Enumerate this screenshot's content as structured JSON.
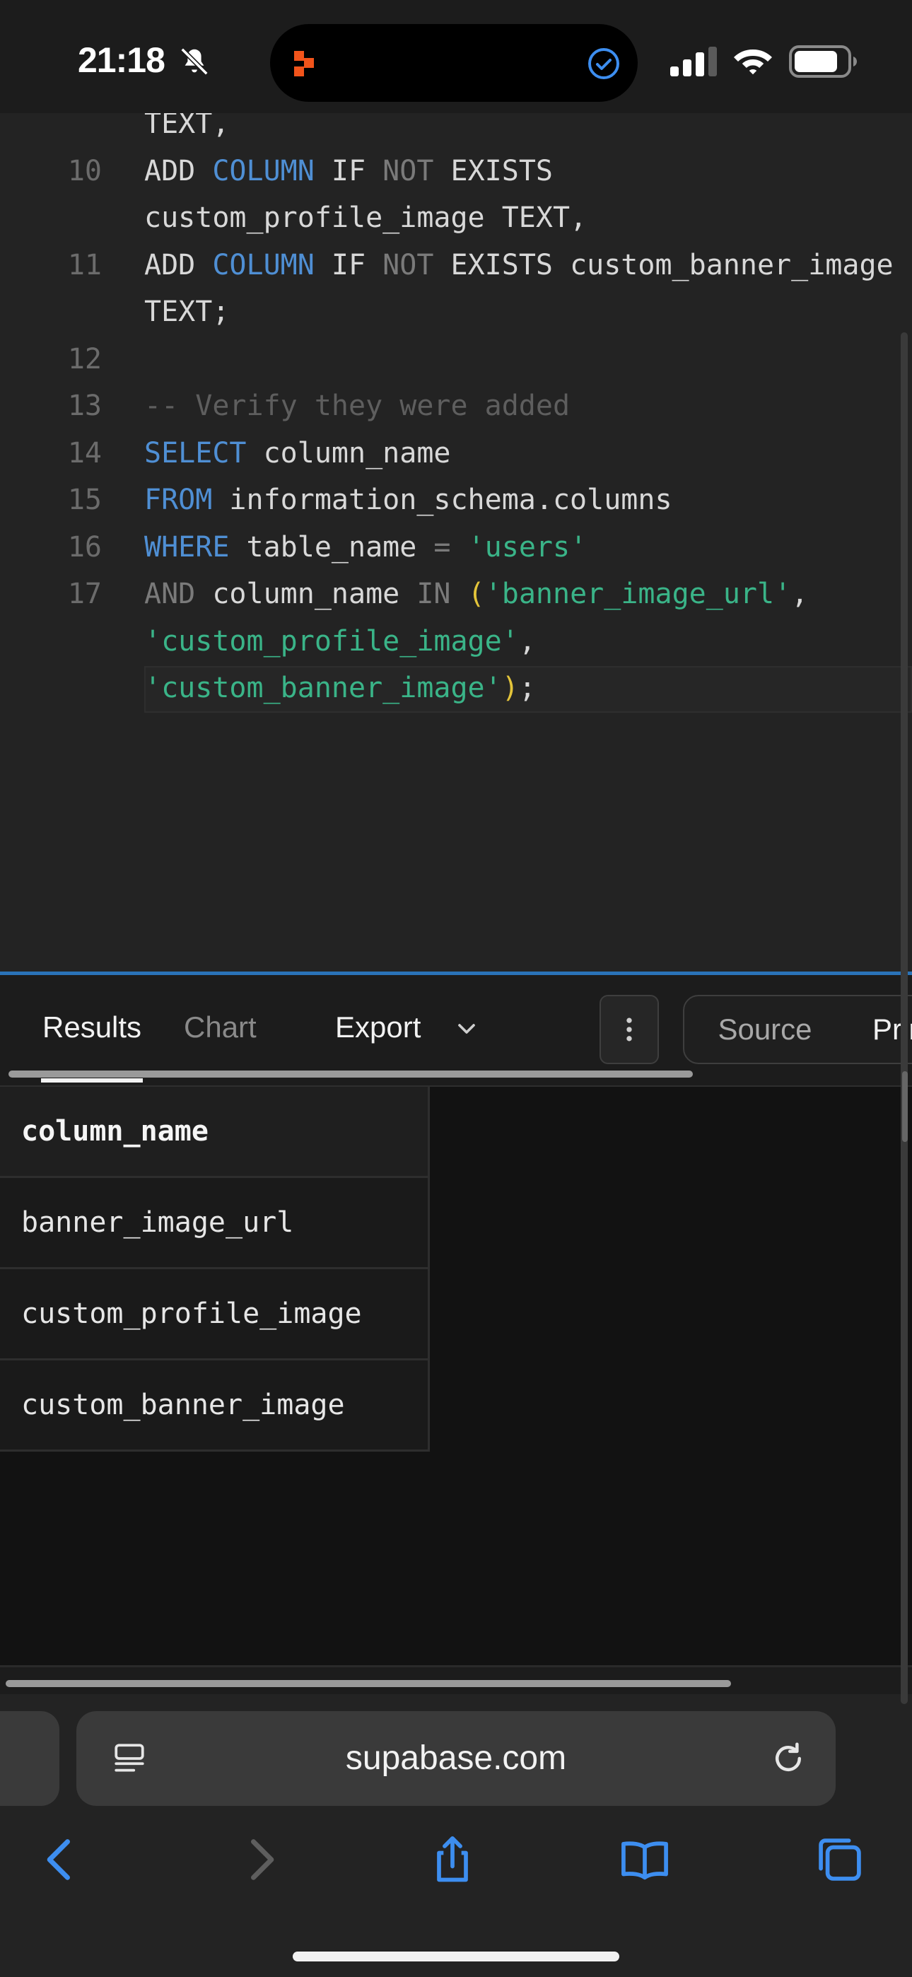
{
  "status_bar": {
    "time": "21:18",
    "icons": [
      "bell-slash-icon",
      "signal-icon",
      "wifi-icon",
      "battery-icon"
    ]
  },
  "editor": {
    "lines": [
      {
        "n": "",
        "tokens": [
          {
            "t": "TEXT,",
            "c": "plain"
          }
        ]
      },
      {
        "n": "10",
        "tokens": [
          {
            "t": "ADD ",
            "c": "plain"
          },
          {
            "t": "COLUMN",
            "c": "kw"
          },
          {
            "t": " IF ",
            "c": "plain"
          },
          {
            "t": "NOT",
            "c": "op"
          },
          {
            "t": " EXISTS",
            "c": "plain"
          }
        ]
      },
      {
        "n": "",
        "tokens": [
          {
            "t": "custom_profile_image TEXT,",
            "c": "plain"
          }
        ]
      },
      {
        "n": "11",
        "tokens": [
          {
            "t": "ADD ",
            "c": "plain"
          },
          {
            "t": "COLUMN",
            "c": "kw"
          },
          {
            "t": " IF ",
            "c": "plain"
          },
          {
            "t": "NOT",
            "c": "op"
          },
          {
            "t": " EXISTS custom_banner_image",
            "c": "plain"
          }
        ]
      },
      {
        "n": "",
        "tokens": [
          {
            "t": "TEXT;",
            "c": "plain"
          }
        ]
      },
      {
        "n": "12",
        "tokens": []
      },
      {
        "n": "13",
        "tokens": [
          {
            "t": "-- Verify they were added",
            "c": "cm"
          }
        ]
      },
      {
        "n": "14",
        "tokens": [
          {
            "t": "SELECT",
            "c": "kw"
          },
          {
            "t": " column_name",
            "c": "plain"
          }
        ]
      },
      {
        "n": "15",
        "tokens": [
          {
            "t": "FROM",
            "c": "kw"
          },
          {
            "t": " information_schema.columns",
            "c": "plain"
          }
        ]
      },
      {
        "n": "16",
        "tokens": [
          {
            "t": "WHERE",
            "c": "kw"
          },
          {
            "t": " table_name ",
            "c": "plain"
          },
          {
            "t": "=",
            "c": "op"
          },
          {
            "t": " ",
            "c": "plain"
          },
          {
            "t": "'users'",
            "c": "str"
          }
        ]
      },
      {
        "n": "17",
        "tokens": [
          {
            "t": "AND",
            "c": "op"
          },
          {
            "t": " column_name ",
            "c": "plain"
          },
          {
            "t": "IN",
            "c": "op"
          },
          {
            "t": " ",
            "c": "plain"
          },
          {
            "t": "(",
            "c": "par"
          },
          {
            "t": "'banner_image_url'",
            "c": "str"
          },
          {
            "t": ",",
            "c": "plain"
          }
        ]
      },
      {
        "n": "",
        "tokens": [
          {
            "t": "'custom_profile_image'",
            "c": "str"
          },
          {
            "t": ",",
            "c": "plain"
          }
        ]
      },
      {
        "n": "",
        "tokens": [
          {
            "t": "'custom_banner_image'",
            "c": "str"
          },
          {
            "t": ")",
            "c": "par"
          },
          {
            "t": ";",
            "c": "plain"
          }
        ]
      }
    ]
  },
  "toolbar": {
    "tab_results": "Results",
    "tab_chart": "Chart",
    "export_label": "Export",
    "source_label": "Source",
    "primary_label": "Primary"
  },
  "results": {
    "header": "column_name",
    "rows": [
      "banner_image_url",
      "custom_profile_image",
      "custom_banner_image"
    ]
  },
  "browser": {
    "url": "supabase.com"
  },
  "colors": {
    "keyword": "#4f8fd4",
    "string": "#3ab488",
    "comment": "#5e5e5e",
    "divider": "#2a73b8",
    "browser_icon": "#3d8ef0"
  }
}
